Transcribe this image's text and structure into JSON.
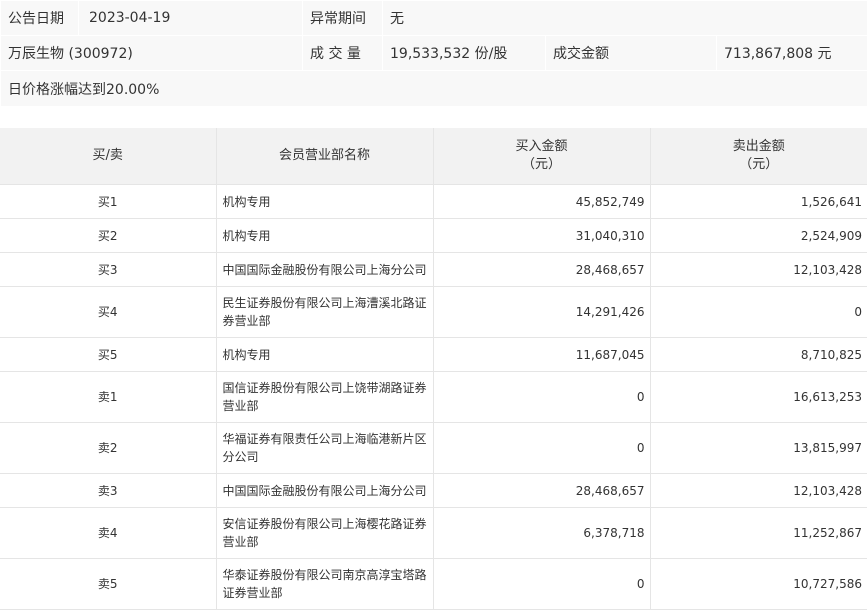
{
  "header": {
    "date_label": "公告日期",
    "date_value": "2023-04-19",
    "period_label": "异常期间",
    "period_value": "无",
    "stock_name": "万辰生物 (300972)",
    "volume_label": "成 交 量",
    "volume_value": "19,533,532 份/股",
    "amount_label": "成交金额",
    "amount_value": "713,867,808 元",
    "reason": "日价格涨幅达到20.00%"
  },
  "table": {
    "headers": {
      "direction": "买/卖",
      "branch": "会员营业部名称",
      "buy_line1": "买入金额",
      "buy_line2": "（元）",
      "sell_line1": "卖出金额",
      "sell_line2": "（元）"
    },
    "rows": [
      {
        "dir": "买1",
        "name": "机构专用",
        "buy": "45,852,749",
        "sell": "1,526,641"
      },
      {
        "dir": "买2",
        "name": "机构专用",
        "buy": "31,040,310",
        "sell": "2,524,909"
      },
      {
        "dir": "买3",
        "name": "中国国际金融股份有限公司上海分公司",
        "buy": "28,468,657",
        "sell": "12,103,428"
      },
      {
        "dir": "买4",
        "name": "民生证券股份有限公司上海漕溪北路证券营业部",
        "buy": "14,291,426",
        "sell": "0"
      },
      {
        "dir": "买5",
        "name": "机构专用",
        "buy": "11,687,045",
        "sell": "8,710,825"
      },
      {
        "dir": "卖1",
        "name": "国信证券股份有限公司上饶带湖路证券营业部",
        "buy": "0",
        "sell": "16,613,253"
      },
      {
        "dir": "卖2",
        "name": "华福证券有限责任公司上海临港新片区分公司",
        "buy": "0",
        "sell": "13,815,997"
      },
      {
        "dir": "卖3",
        "name": "中国国际金融股份有限公司上海分公司",
        "buy": "28,468,657",
        "sell": "12,103,428"
      },
      {
        "dir": "卖4",
        "name": "安信证券股份有限公司上海樱花路证券营业部",
        "buy": "6,378,718",
        "sell": "11,252,867"
      },
      {
        "dir": "卖5",
        "name": "华泰证券股份有限公司南京高淳宝塔路证券营业部",
        "buy": "0",
        "sell": "10,727,586"
      }
    ]
  }
}
